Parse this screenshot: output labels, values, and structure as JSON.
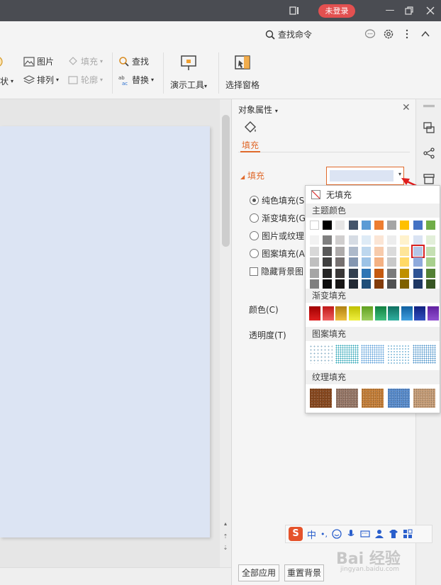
{
  "titlebar": {
    "login_label": "未登录",
    "icons": [
      "reader-mode-icon",
      "minimize-icon",
      "restore-icon",
      "close-icon"
    ]
  },
  "command_bar": {
    "search_label": "查找命令",
    "icons": [
      "search-icon",
      "chat-icon",
      "settings-icon",
      "more-icon",
      "collapse-ribbon-icon"
    ]
  },
  "ribbon": {
    "shape_label": "状",
    "picture_label": "图片",
    "fill_label": "填充",
    "arrange_label": "排列",
    "outline_label": "轮廓",
    "find_label": "查找",
    "replace_label": "替换",
    "presentation_tools_label": "演示工具",
    "selection_pane_label": "选择窗格"
  },
  "panel": {
    "title": "对象属性",
    "tab_fill": "填充",
    "section_fill": "填充",
    "options": [
      {
        "label": "纯色填充(S",
        "checked": true
      },
      {
        "label": "渐变填充(G",
        "checked": false
      },
      {
        "label": "图片或纹理",
        "checked": false
      },
      {
        "label": "图案填充(A",
        "checked": false
      }
    ],
    "hide_bg_label": "隐藏背景图",
    "color_label": "颜色(C)",
    "transparency_label": "透明度(T)",
    "apply_all_label": "全部应用",
    "reset_bg_label": "重置背景",
    "current_color": "#dce4f3"
  },
  "dropdown": {
    "no_fill_label": "无填充",
    "theme_colors_label": "主题颜色",
    "gradient_label": "渐变填充",
    "pattern_label": "图案填充",
    "texture_label": "纹理填充",
    "theme_top": [
      "#ffffff",
      "#000000",
      "#e7e6e6",
      "#44546a",
      "#5b9bd5",
      "#ed7d31",
      "#a5a5a5",
      "#ffc000",
      "#4472c4",
      "#70ad47"
    ],
    "theme_shades": [
      [
        "#f2f2f2",
        "#7f7f7f",
        "#d0cece",
        "#d6dce4",
        "#deebf6",
        "#fbe5d5",
        "#ededed",
        "#fff2cc",
        "#dae3f3",
        "#e2efd9"
      ],
      [
        "#d8d8d8",
        "#595959",
        "#aeabab",
        "#adb9ca",
        "#bdd7ee",
        "#f7cbac",
        "#dbdbdb",
        "#fee599",
        "#b4c6e7",
        "#c5e0b3"
      ],
      [
        "#bfbfbf",
        "#3f3f3f",
        "#757070",
        "#8496b0",
        "#9dc3e6",
        "#f4b183",
        "#c9c9c9",
        "#ffd966",
        "#8faadc",
        "#a8d08d"
      ],
      [
        "#a5a5a5",
        "#262626",
        "#3a3838",
        "#323f4f",
        "#2e75b5",
        "#c55a11",
        "#7b7b7b",
        "#bf9000",
        "#2f5496",
        "#538135"
      ],
      [
        "#7f7f7f",
        "#0c0c0c",
        "#171616",
        "#222a35",
        "#1e4e79",
        "#833c0b",
        "#525252",
        "#7f6000",
        "#1f3864",
        "#375623"
      ]
    ],
    "selected_swatch": "row1-col8",
    "gradients": [
      [
        "#a00000",
        "#e02020"
      ],
      [
        "#c01818",
        "#f06060"
      ],
      [
        "#b08010",
        "#f0c040"
      ],
      [
        "#c0c000",
        "#f0f040"
      ],
      [
        "#60a020",
        "#a0d060"
      ],
      [
        "#108040",
        "#40c080"
      ],
      [
        "#107060",
        "#30b0a0"
      ],
      [
        "#1060a0",
        "#40a0e0"
      ],
      [
        "#102080",
        "#3050c0"
      ],
      [
        "#6020a0",
        "#9050d0"
      ]
    ],
    "patterns": [
      "dots-sparse",
      "dots-teal",
      "dots-dense",
      "dots-light",
      "dots-blue"
    ],
    "textures": [
      "#8b4a20",
      "#9a7a6a",
      "#c8813a",
      "#5b8fd0",
      "#c9a07a"
    ]
  },
  "ime": {
    "logo": "S",
    "lang": "中",
    "punct": "•,",
    "icons": [
      "emoji-icon",
      "mic-icon",
      "keyboard-icon",
      "user-icon",
      "shirt-icon",
      "grid-icon"
    ]
  },
  "watermark": {
    "main": "Bai 经验",
    "sub": "jingyan.baidu.com"
  }
}
